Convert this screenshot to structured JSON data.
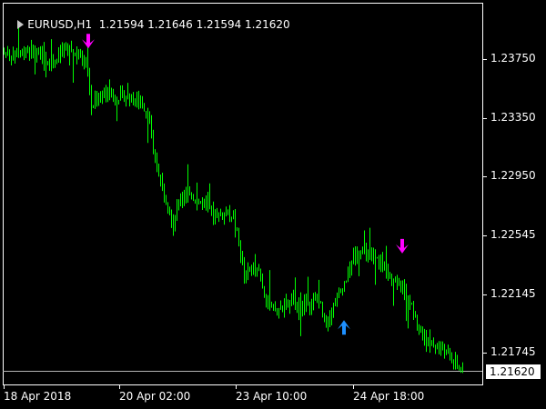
{
  "header": {
    "symbol": "EURUSD,H1",
    "ohlc": "1.21594 1.21646 1.21594 1.21620",
    "icon": "chart-menu-arrow-icon"
  },
  "y_axis": {
    "ticks": [
      "1.23750",
      "1.23350",
      "1.22950",
      "1.22545",
      "1.22145",
      "1.21745"
    ],
    "current_price": "1.21620"
  },
  "x_axis": {
    "ticks": [
      "18 Apr 2018",
      "20 Apr 02:00",
      "23 Apr 10:00",
      "24 Apr 18:00"
    ]
  },
  "colors": {
    "background": "#000000",
    "candles": "#00ff00",
    "sell_arrow": "#ff00ff",
    "buy_arrow": "#1e90ff",
    "axis": "#ffffff",
    "price_line": "#b4b4b4"
  },
  "chart_data": {
    "type": "line",
    "ylim": [
      1.2155,
      1.2415
    ],
    "keypoints": [
      [
        0,
        1.238
      ],
      [
        15,
        1.2378
      ],
      [
        30,
        1.2382
      ],
      [
        45,
        1.2376
      ],
      [
        55,
        1.2372
      ],
      [
        65,
        1.2378
      ],
      [
        75,
        1.2382
      ],
      [
        85,
        1.2378
      ],
      [
        93,
        1.2373
      ],
      [
        97,
        1.236
      ],
      [
        100,
        1.234
      ],
      [
        105,
        1.2349
      ],
      [
        115,
        1.2352
      ],
      [
        125,
        1.2349
      ],
      [
        140,
        1.2349
      ],
      [
        155,
        1.2345
      ],
      [
        163,
        1.2337
      ],
      [
        168,
        1.231
      ],
      [
        175,
        1.2295
      ],
      [
        183,
        1.2278
      ],
      [
        190,
        1.2262
      ],
      [
        197,
        1.2278
      ],
      [
        205,
        1.2285
      ],
      [
        215,
        1.2278
      ],
      [
        225,
        1.2275
      ],
      [
        235,
        1.2268
      ],
      [
        245,
        1.227
      ],
      [
        255,
        1.2268
      ],
      [
        262,
        1.225
      ],
      [
        268,
        1.2225
      ],
      [
        275,
        1.2232
      ],
      [
        285,
        1.223
      ],
      [
        292,
        1.221
      ],
      [
        300,
        1.2202
      ],
      [
        310,
        1.2205
      ],
      [
        320,
        1.221
      ],
      [
        330,
        1.2208
      ],
      [
        340,
        1.2207
      ],
      [
        350,
        1.2212
      ],
      [
        357,
        1.2195
      ],
      [
        365,
        1.2205
      ],
      [
        372,
        1.2215
      ],
      [
        380,
        1.2225
      ],
      [
        388,
        1.224
      ],
      [
        396,
        1.2245
      ],
      [
        405,
        1.224
      ],
      [
        415,
        1.2238
      ],
      [
        425,
        1.2232
      ],
      [
        432,
        1.2225
      ],
      [
        440,
        1.222
      ],
      [
        450,
        1.221
      ],
      [
        458,
        1.2195
      ],
      [
        465,
        1.2185
      ],
      [
        475,
        1.218
      ],
      [
        485,
        1.2178
      ],
      [
        495,
        1.217
      ],
      [
        505,
        1.2163
      ],
      [
        510,
        1.2162
      ]
    ],
    "signals": [
      {
        "type": "sell",
        "x": 97,
        "price": 1.2386
      },
      {
        "type": "buy",
        "x": 378,
        "price": 1.2193
      },
      {
        "type": "sell",
        "x": 442,
        "price": 1.2246
      }
    ]
  }
}
